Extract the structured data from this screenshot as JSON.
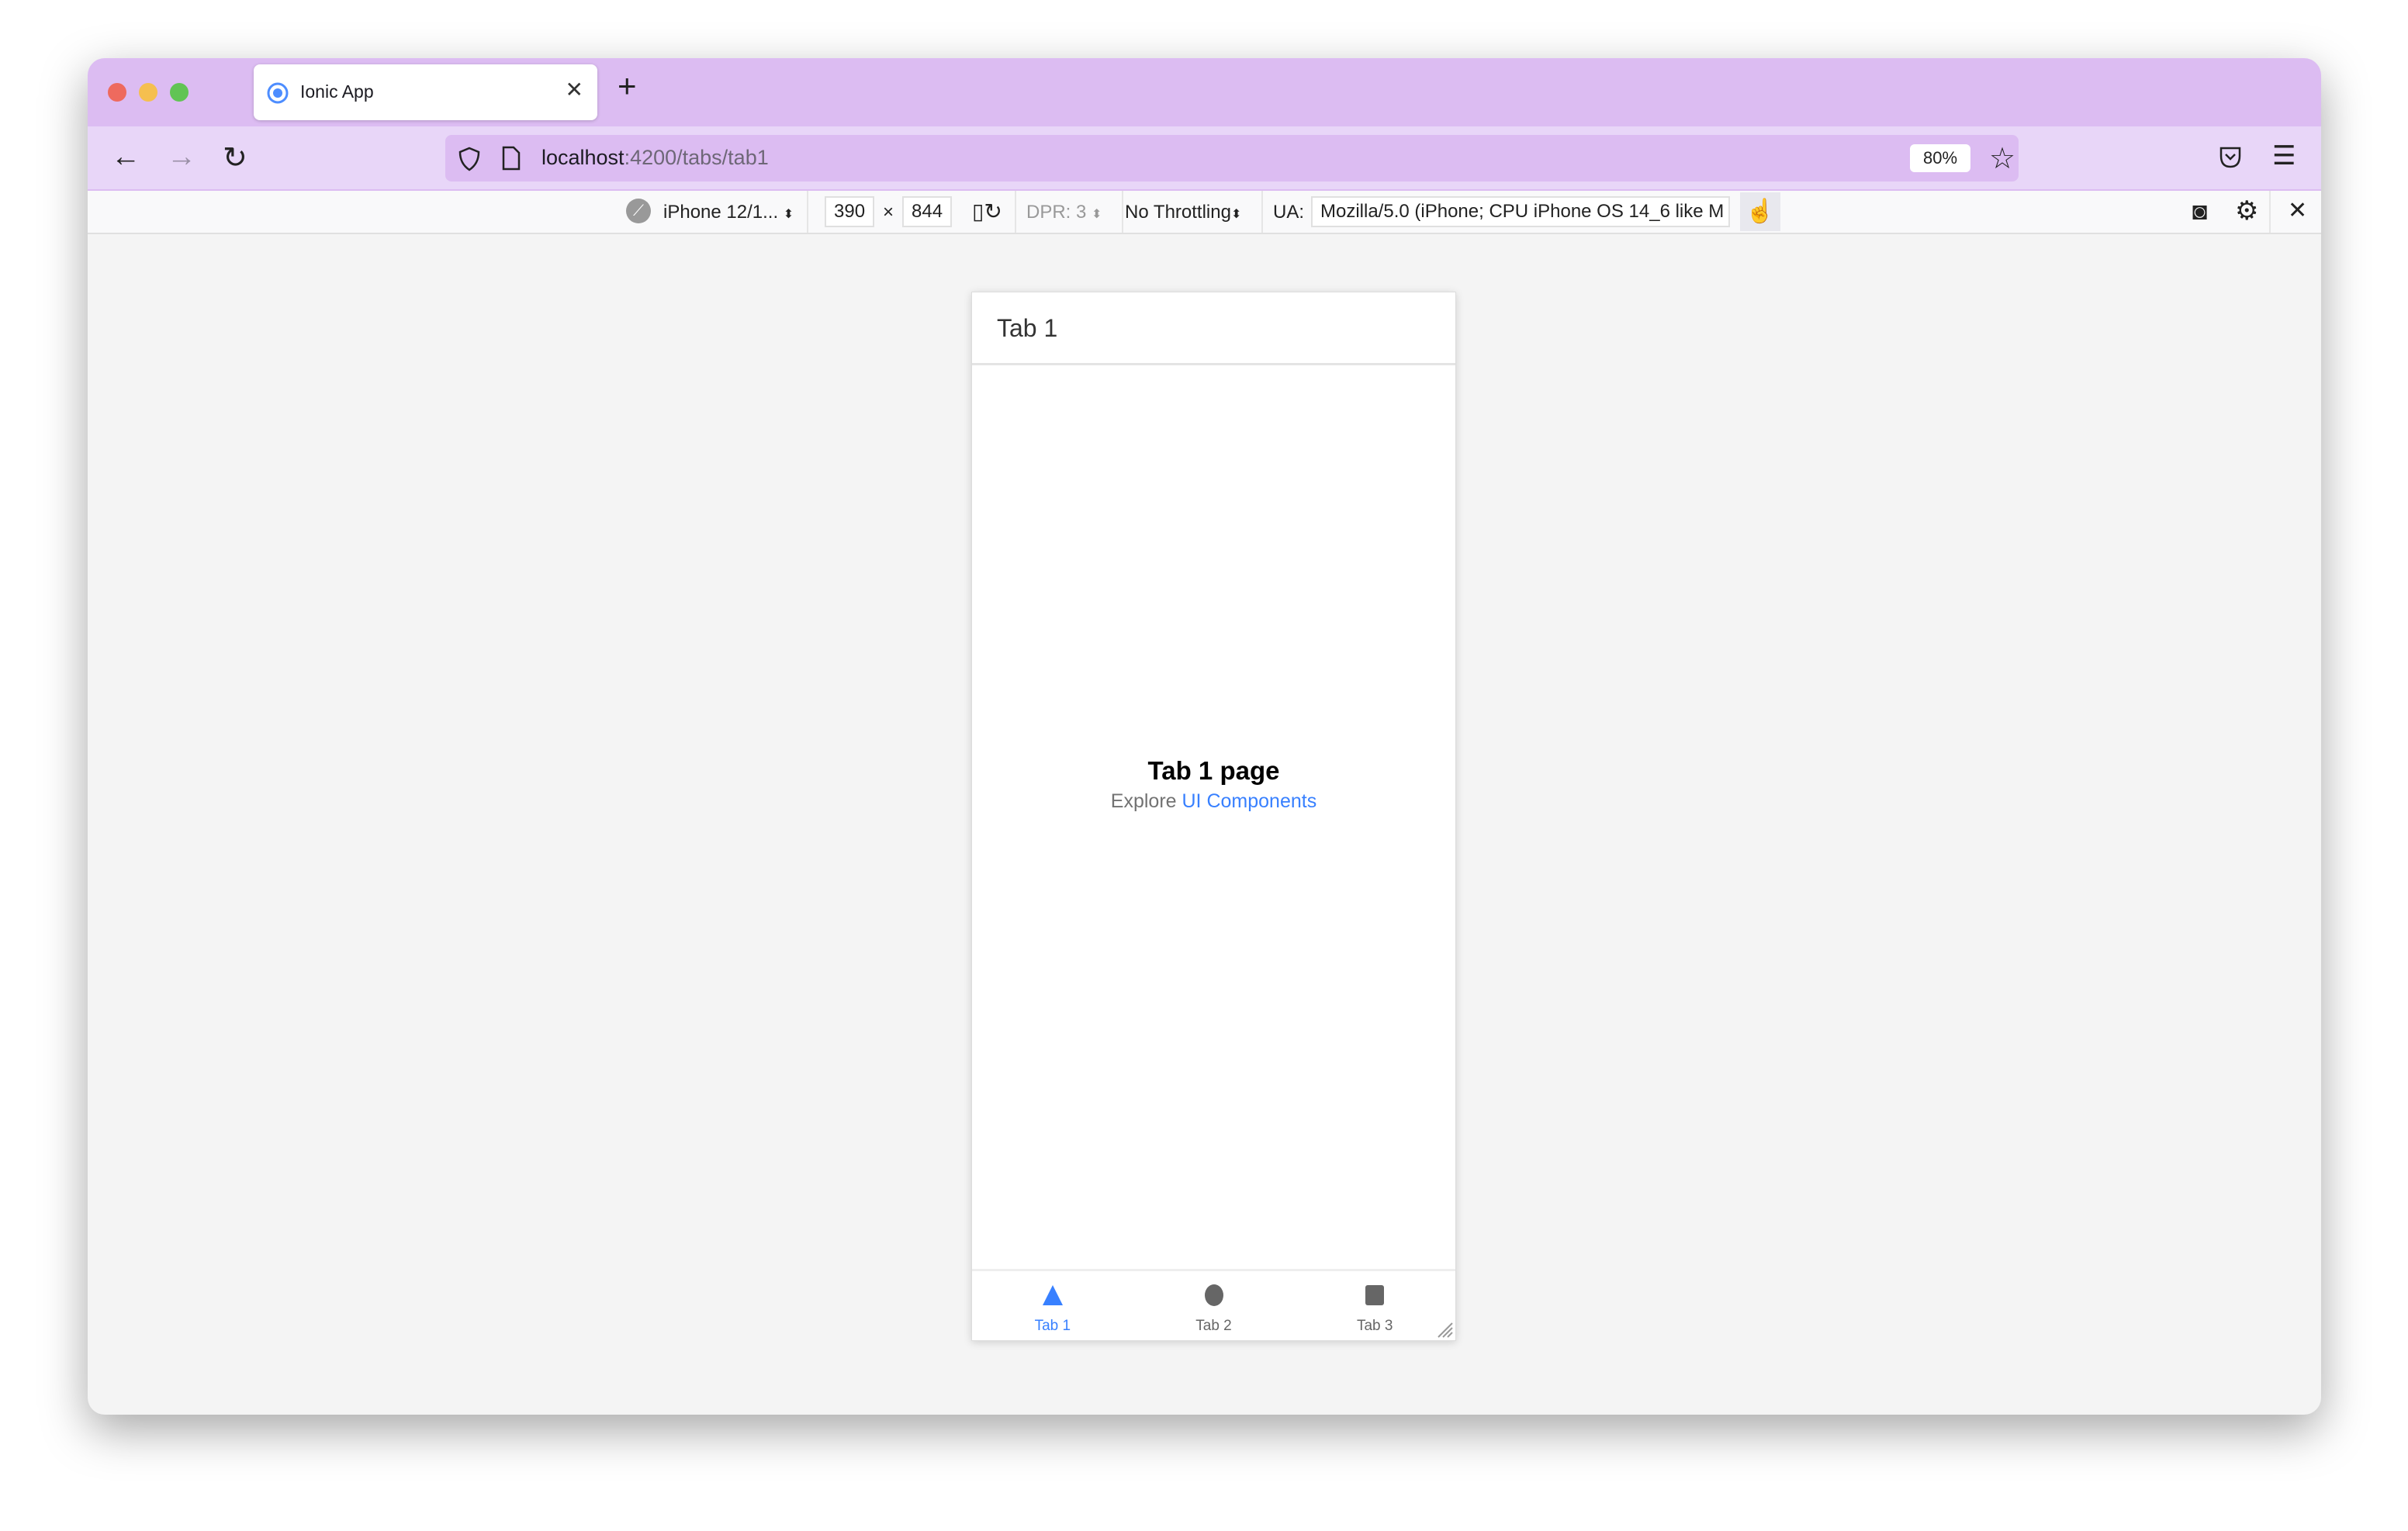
{
  "browser": {
    "tab_title": "Ionic App",
    "url_host": "localhost",
    "url_rest": ":4200/tabs/tab1",
    "zoom": "80%"
  },
  "devtools": {
    "device": "iPhone 12/1...",
    "width": "390",
    "times": "×",
    "height": "844",
    "dpr": "DPR: 3",
    "throttling": "No Throttling",
    "ua_label": "UA:",
    "ua_value": "Mozilla/5.0 (iPhone; CPU iPhone OS 14_6 like M"
  },
  "app": {
    "header_title": "Tab 1",
    "page_heading": "Tab 1 page",
    "explore_text": "Explore",
    "explore_link": "UI Components",
    "tabs": [
      {
        "label": "Tab 1",
        "icon": "triangle",
        "active": true
      },
      {
        "label": "Tab 2",
        "icon": "ellipse",
        "active": false
      },
      {
        "label": "Tab 3",
        "icon": "square",
        "active": false
      }
    ]
  },
  "colors": {
    "accent": "#3880ff",
    "chrome": "#dcbcf2"
  }
}
